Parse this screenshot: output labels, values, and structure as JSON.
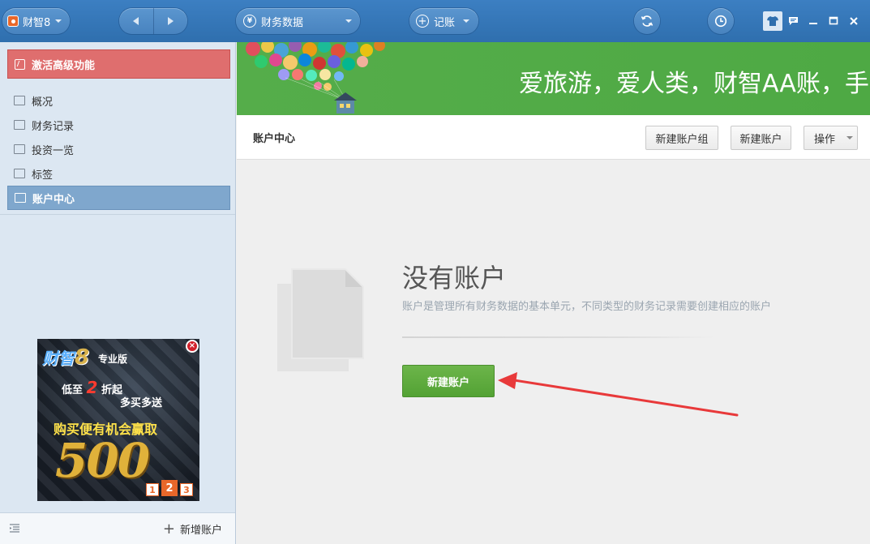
{
  "titlebar": {
    "app_name": "财智8",
    "data_menu": "财务数据",
    "bookkeeping_menu": "记账",
    "data_icon_glyph": "¥",
    "book_icon_glyph": "+"
  },
  "sidebar": {
    "activate_label": "激活高级功能",
    "items": [
      {
        "label": "概况",
        "icon": "overview-icon"
      },
      {
        "label": "财务记录",
        "icon": "records-icon"
      },
      {
        "label": "投资一览",
        "icon": "investment-icon"
      },
      {
        "label": "标签",
        "icon": "tags-icon"
      },
      {
        "label": "账户中心",
        "icon": "account-center-icon",
        "active": true
      }
    ],
    "ad": {
      "brand": "财智",
      "brand_version": "8",
      "edition": "专业版",
      "promo_prefix": "低至",
      "promo_number": "2",
      "promo_suffix": "折起",
      "promo_line2": "多买多送",
      "promo_line3": "购买便有机会赢取",
      "big_number": "500",
      "pages": [
        "1",
        "2",
        "3"
      ],
      "active_page": "2",
      "close_glyph": "×"
    },
    "footer": {
      "add_account_label": "新增账户"
    }
  },
  "banner": {
    "slogan": "爱旅游，爱人类，财智AA账，手"
  },
  "header": {
    "title": "账户中心",
    "new_group_label": "新建账户组",
    "new_account_label": "新建账户",
    "actions_label": "操作"
  },
  "empty_state": {
    "title": "没有账户",
    "subtitle": "账户是管理所有财务数据的基本单元，不同类型的财务记录需要创建相应的账户",
    "button_label": "新建账户"
  },
  "colors": {
    "titlebar": "#3c7fc2",
    "sidebar_bg": "#dce7f2",
    "activate_bg": "#df6e6e",
    "active_nav": "#7fa7cd",
    "banner_green": "#55ad4a",
    "primary_button": "#5fac3e",
    "annotation_arrow": "#e8393a"
  }
}
